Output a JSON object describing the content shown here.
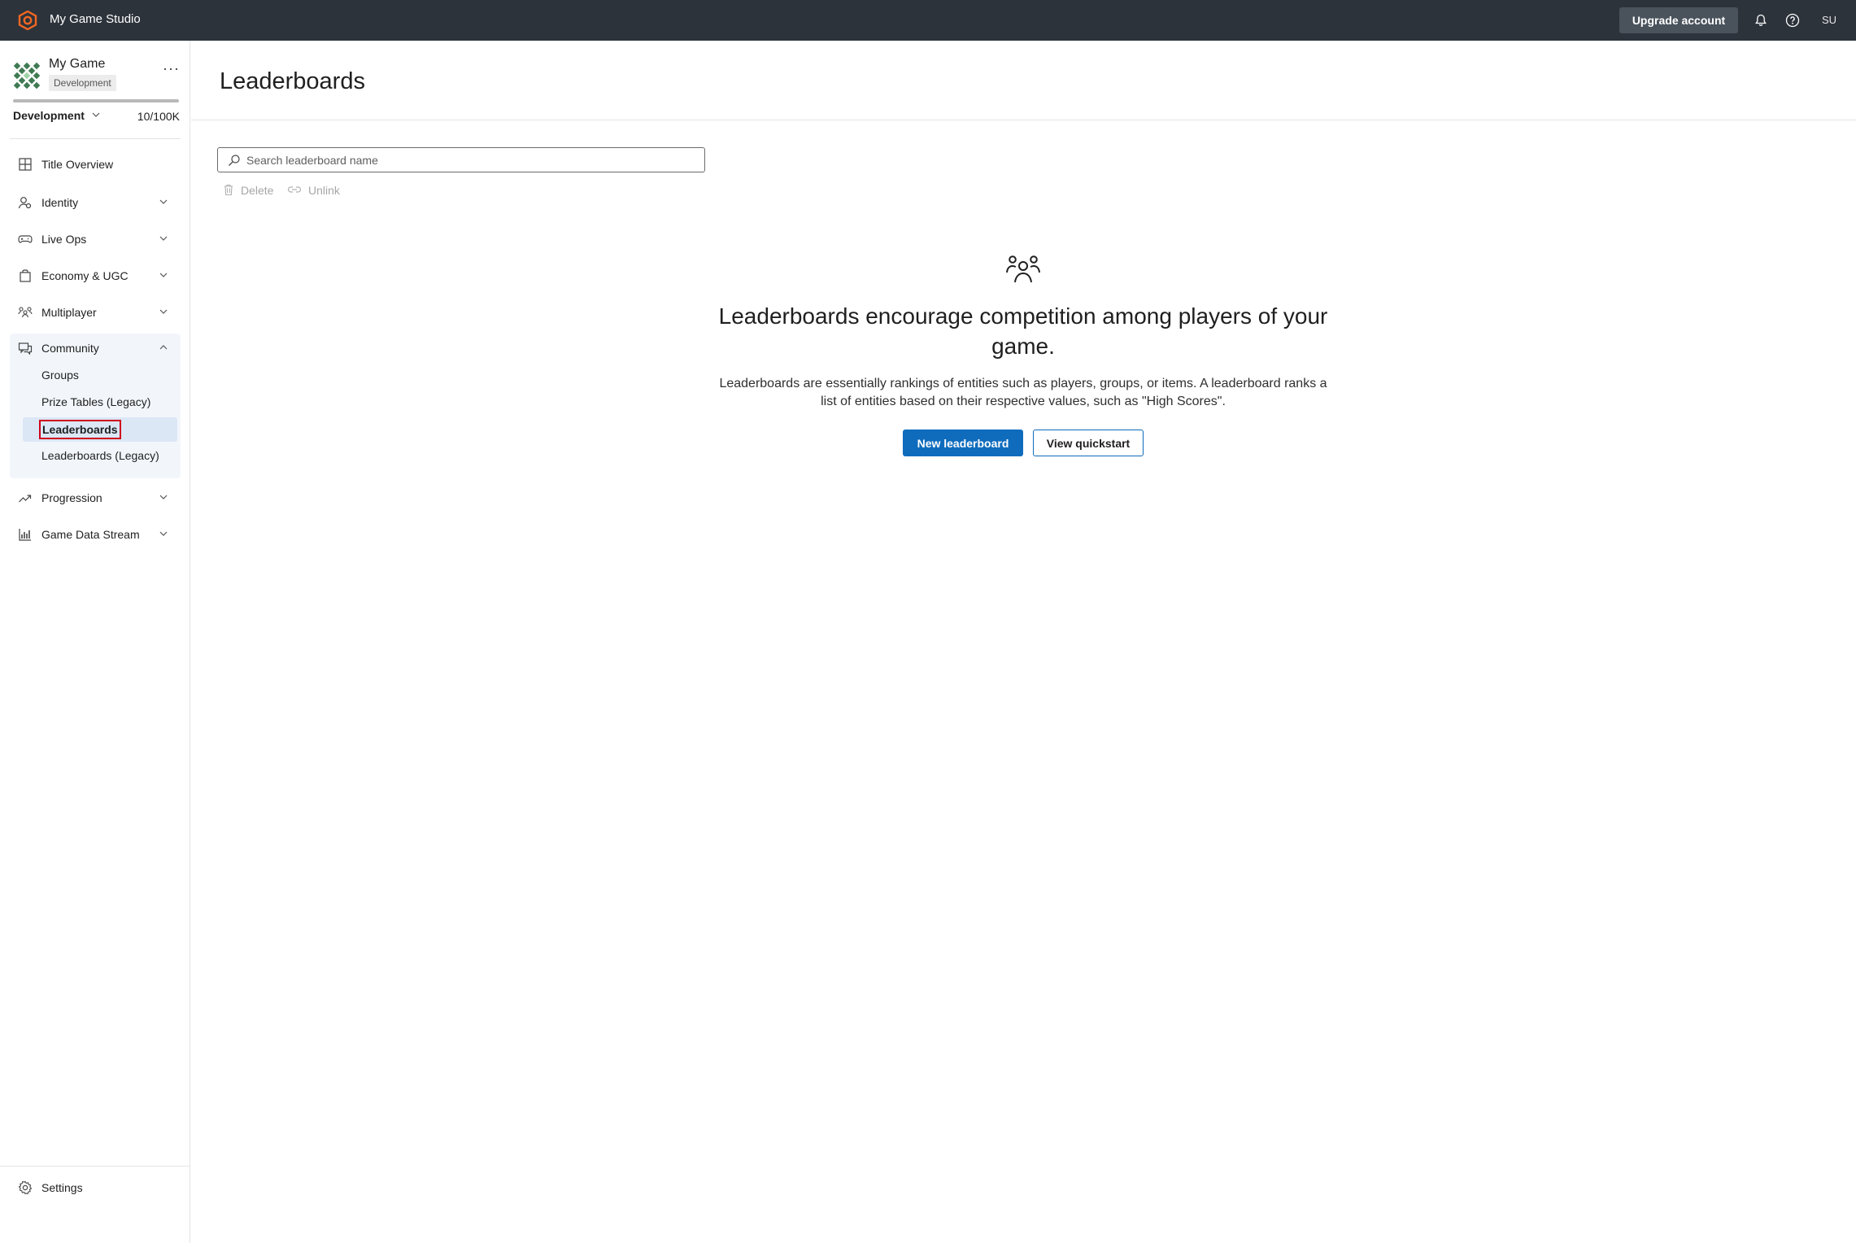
{
  "app": {
    "studio_name": "My Game Studio",
    "upgrade_label": "Upgrade account",
    "user_initials": "SU"
  },
  "sidebar": {
    "game_name": "My Game",
    "env_badge": "Development",
    "env_select": "Development",
    "usage": "10/100K",
    "usage_fraction": 0.0001,
    "items": [
      {
        "label": "Title Overview",
        "icon": "grid-icon"
      },
      {
        "label": "Identity",
        "icon": "identity-icon"
      },
      {
        "label": "Live Ops",
        "icon": "gamepad-icon"
      },
      {
        "label": "Economy & UGC",
        "icon": "shopping-bag-icon"
      },
      {
        "label": "Multiplayer",
        "icon": "multiplayer-icon"
      },
      {
        "label": "Community",
        "icon": "chat-icon"
      },
      {
        "label": "Progression",
        "icon": "trend-icon"
      },
      {
        "label": "Game Data Stream",
        "icon": "bar-chart-icon"
      }
    ],
    "community_sub": [
      "Groups",
      "Prize Tables (Legacy)",
      "Leaderboards",
      "Leaderboards (Legacy)"
    ],
    "settings_label": "Settings"
  },
  "main": {
    "title": "Leaderboards",
    "search_placeholder": "Search leaderboard name",
    "delete_label": "Delete",
    "unlink_label": "Unlink",
    "empty_heading": "Leaderboards encourage competition among players of your game.",
    "empty_desc": "Leaderboards are essentially rankings of entities such as players, groups, or items. A leaderboard ranks a list of entities based on their respective values, such as \"High Scores\".",
    "new_button": "New leaderboard",
    "quickstart_button": "View quickstart"
  },
  "colors": {
    "topbar": "#2d333b",
    "primary": "#0f6cbd",
    "selected_outline": "#d0021b",
    "logo": "#f26722"
  }
}
